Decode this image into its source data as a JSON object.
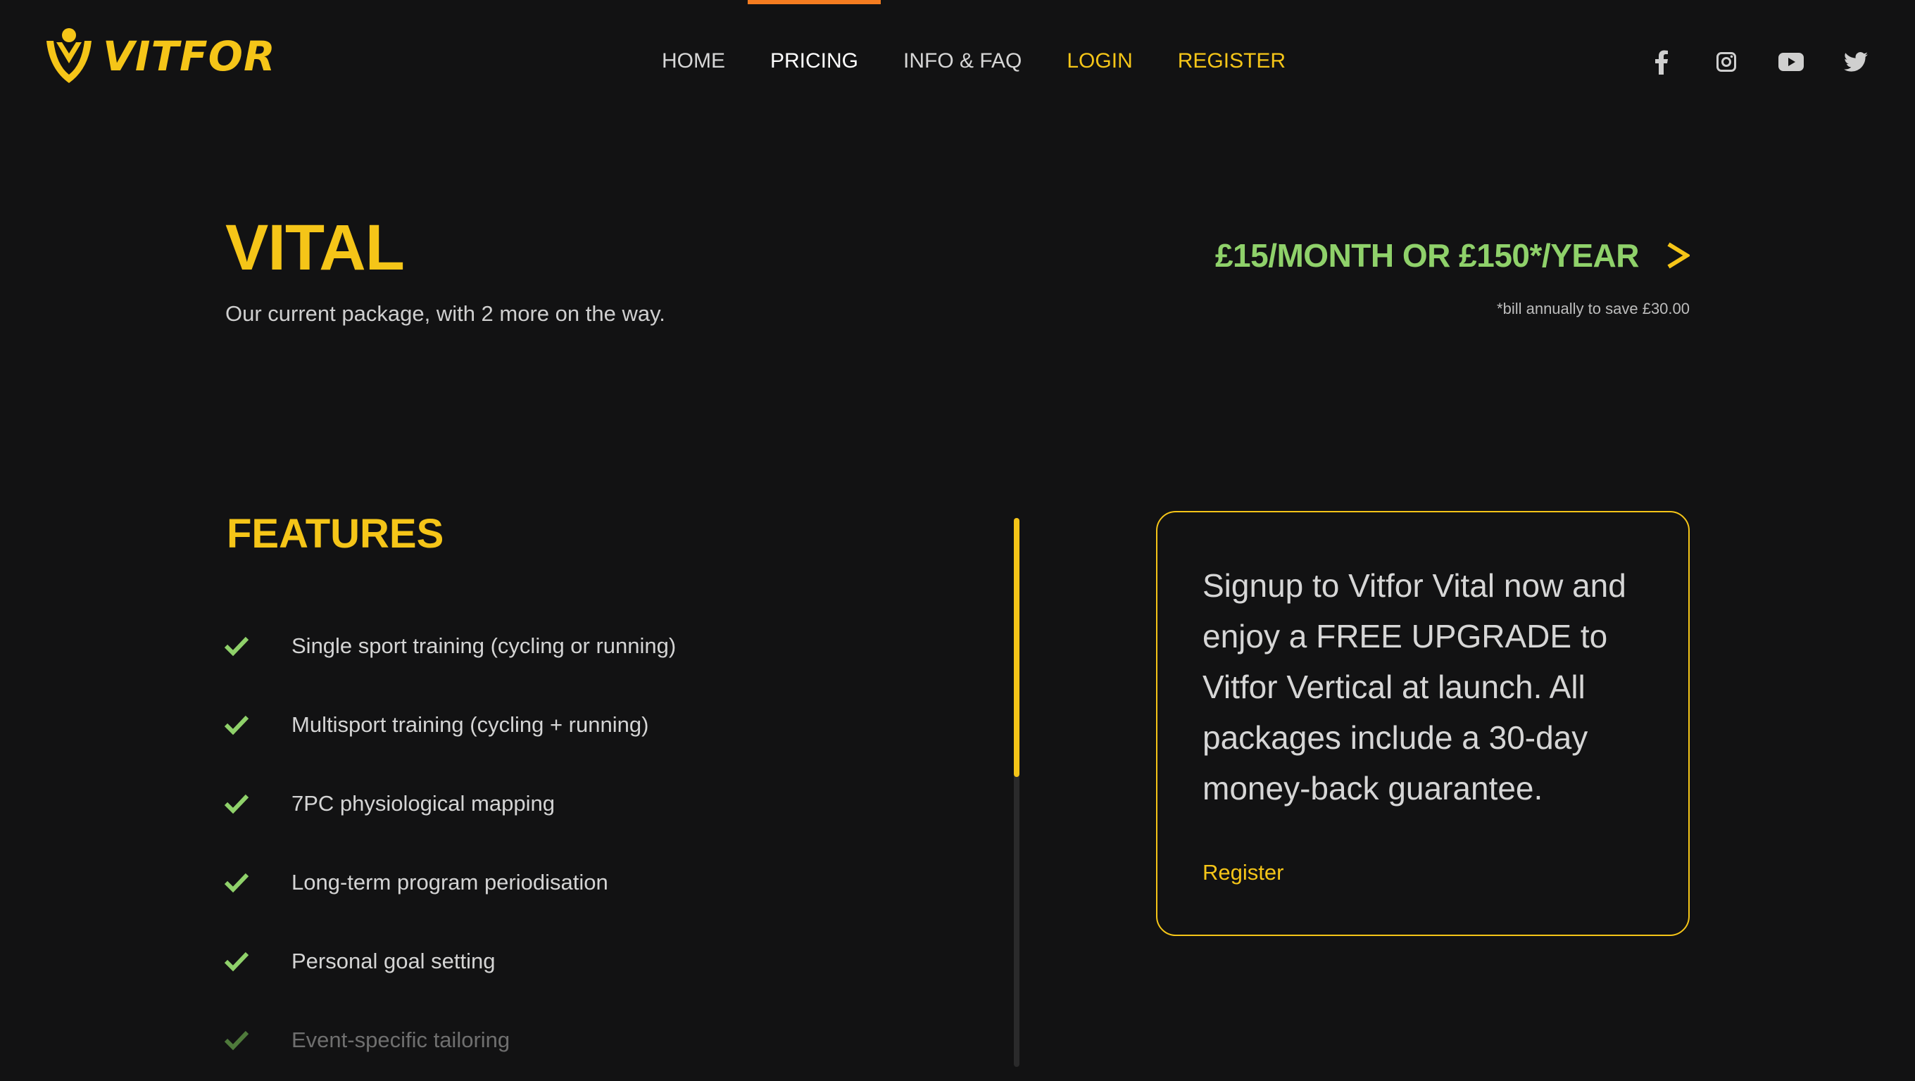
{
  "brand": {
    "name": "VITFOR",
    "accent": "#f5c518"
  },
  "nav": {
    "items": [
      {
        "label": "HOME"
      },
      {
        "label": "PRICING"
      },
      {
        "label": "INFO & FAQ"
      },
      {
        "label": "LOGIN"
      },
      {
        "label": "REGISTER"
      }
    ],
    "active": "PRICING",
    "active_color": "#f47c20"
  },
  "social": [
    "facebook-icon",
    "instagram-icon",
    "youtube-icon",
    "twitter-icon"
  ],
  "plan": {
    "title": "VITAL",
    "subtitle": "Our current package, with 2 more on the way.",
    "price": "£15/MONTH OR £150*/YEAR",
    "price_note": "*bill annually to save £30.00",
    "price_color": "#8fd16a"
  },
  "features": {
    "title": "FEATURES",
    "items": [
      "Single sport training (cycling or running)",
      "Multisport training (cycling + running)",
      "7PC physiological mapping",
      "Long-term program periodisation",
      "Personal goal setting",
      "Event-specific tailoring"
    ],
    "scroll_position": 0.0
  },
  "signup_card": {
    "text": "Signup to Vitfor Vital now and enjoy a FREE UPGRADE to Vitfor Vertical at launch. All packages include a 30-day money-back guarantee.",
    "link": "Register"
  }
}
